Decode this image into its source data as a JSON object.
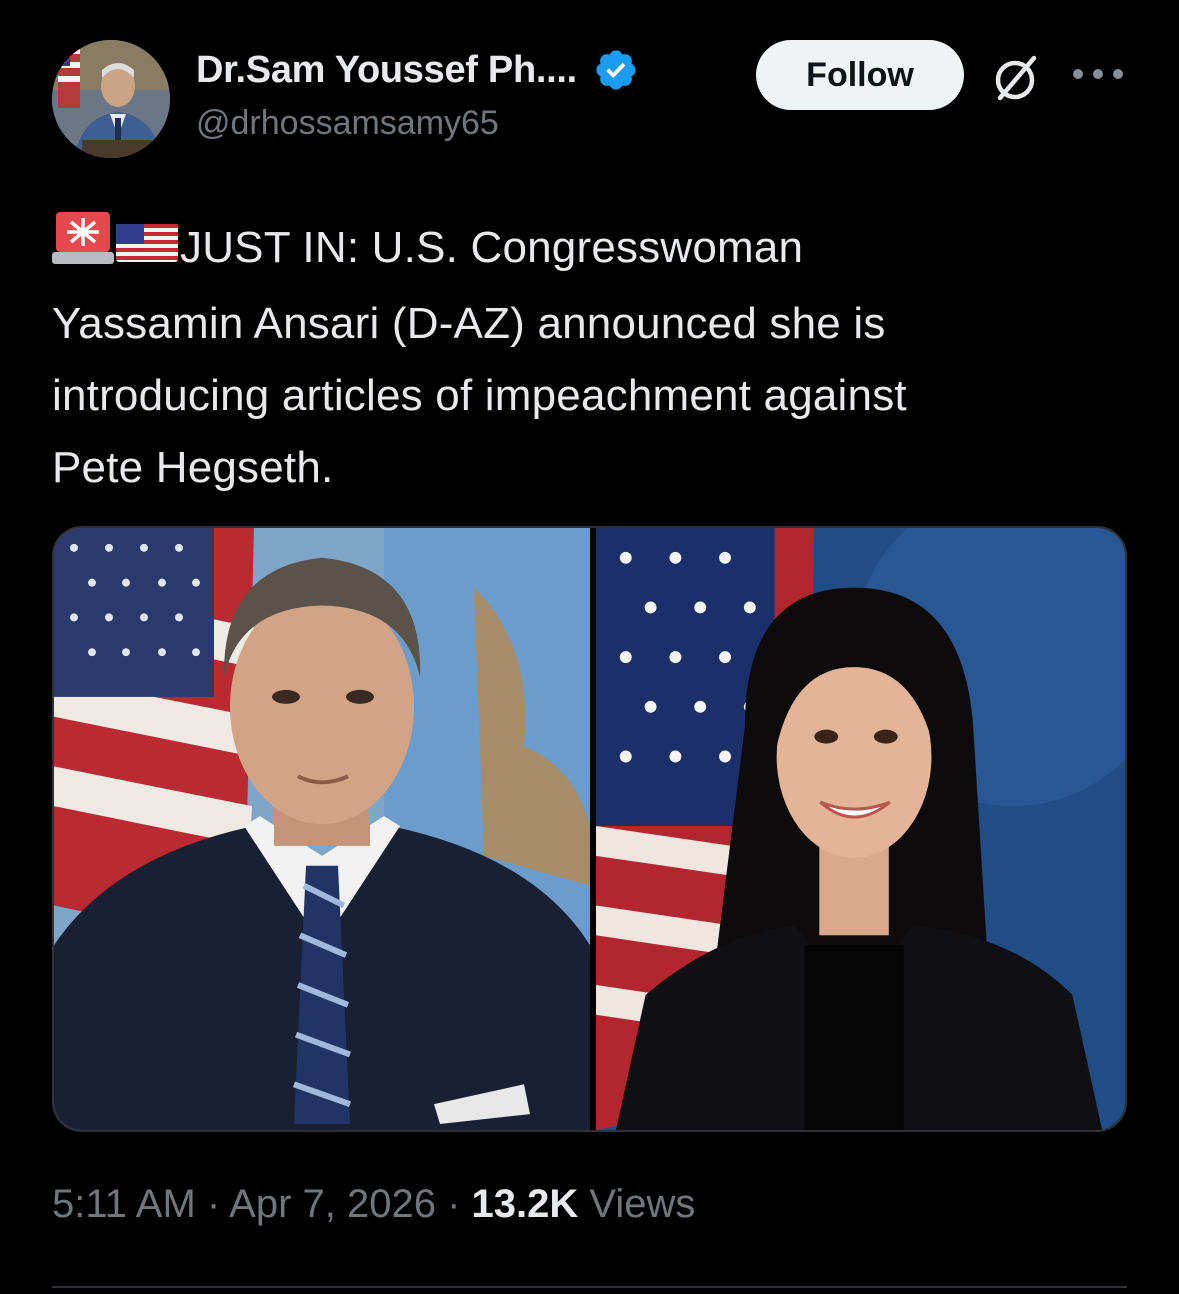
{
  "author": {
    "display_name": "Dr.Sam Youssef Ph....",
    "handle": "@drhossamsamy65",
    "verified": true,
    "verified_color": "#1d9bf0"
  },
  "actions": {
    "follow_label": "Follow"
  },
  "tweet": {
    "lines": [
      "JUST IN: U.S. Congresswoman",
      "Yassamin Ansari (D-AZ) announced she is",
      "introducing articles of impeachment against",
      "Pete Hegseth."
    ],
    "leading_emojis": [
      "rotating-light-emoji",
      "us-flag-emoji"
    ]
  },
  "media": {
    "photos": [
      "man-portrait-photo",
      "woman-portrait-photo"
    ]
  },
  "meta": {
    "time": "5:11 AM",
    "separator": " · ",
    "date": "Apr 7, 2026",
    "views_count": "13.2K",
    "views_label": " Views"
  },
  "icons": {
    "verified": "verified-badge-icon",
    "grok": "grok-icon",
    "more": "more-options-icon"
  }
}
